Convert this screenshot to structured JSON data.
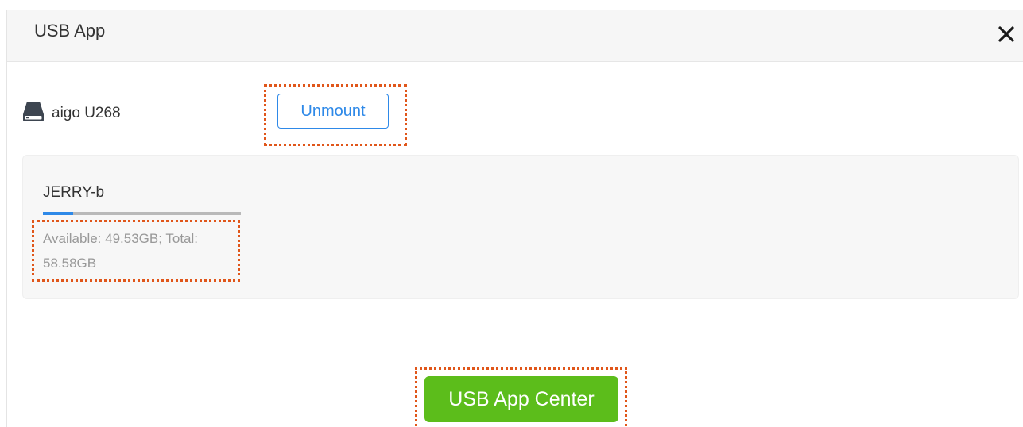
{
  "dialog": {
    "title": "USB App",
    "close_icon": "close-icon"
  },
  "device": {
    "icon": "hard-drive-icon",
    "name": "aigo U268",
    "unmount_label": "Unmount"
  },
  "partition": {
    "name": "JERRY-b",
    "used_fraction": 0.154,
    "space_text": "Available: 49.53GB; Total: 58.58GB"
  },
  "footer": {
    "app_center_label": "USB App Center"
  },
  "colors": {
    "accent_blue": "#2e89e8",
    "button_green": "#5cbd1b",
    "callout_orange": "#e0561a"
  }
}
